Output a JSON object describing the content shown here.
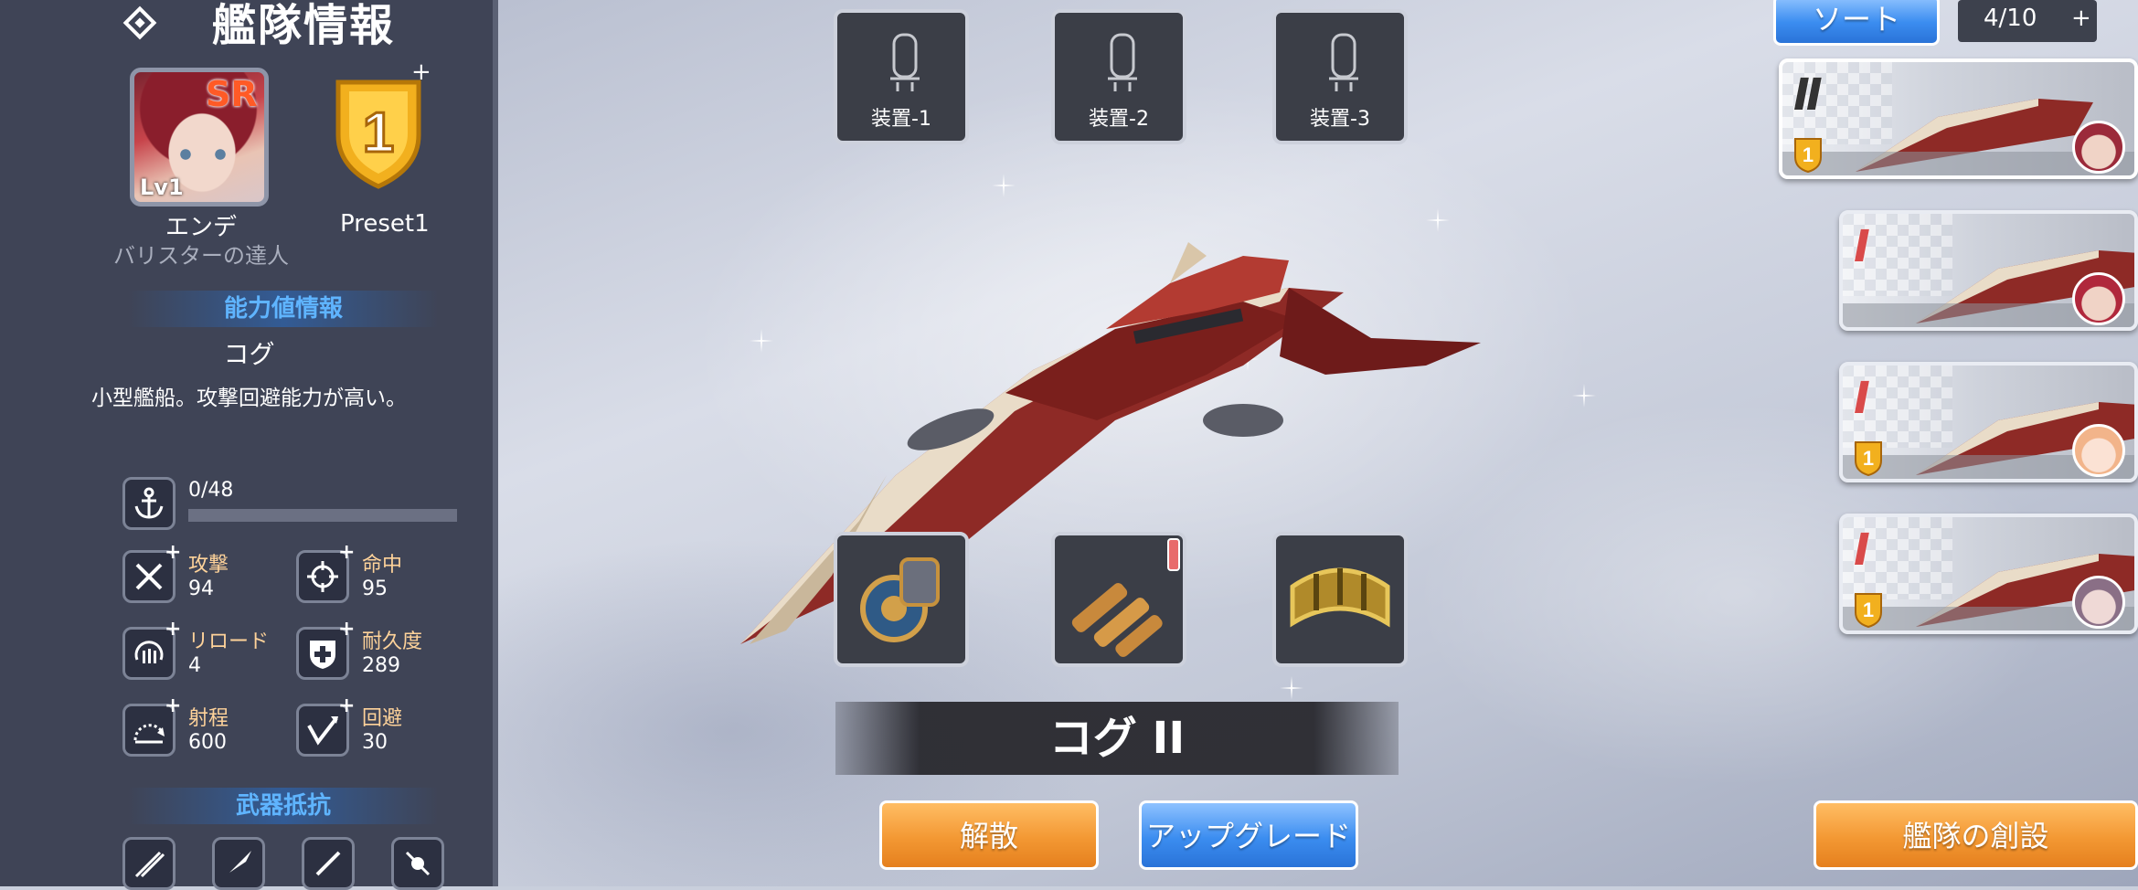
{
  "left_panel": {
    "title": "艦隊情報",
    "character": {
      "rarity": "SR",
      "level": "Lv1",
      "name": "エンデ",
      "title": "バリスターの達人"
    },
    "preset": {
      "number": "1",
      "label": "Preset1",
      "add": "+"
    },
    "ability_section": {
      "title": "能力値情報",
      "ship_type": "コグ",
      "description": "小型艦船。攻撃回避能力が高い。"
    },
    "cost": {
      "text": "0/48",
      "current": 0,
      "max": 48
    },
    "stats": [
      {
        "label": "攻撃",
        "value": "94",
        "icon": "crossed-swords-icon"
      },
      {
        "label": "命中",
        "value": "95",
        "icon": "crosshair-icon"
      },
      {
        "label": "リロード",
        "value": "4",
        "icon": "reload-icon"
      },
      {
        "label": "耐久度",
        "value": "289",
        "icon": "durability-shield-icon"
      },
      {
        "label": "射程",
        "value": "600",
        "icon": "range-icon"
      },
      {
        "label": "回避",
        "value": "30",
        "icon": "evasion-icon"
      }
    ],
    "weapon_section": {
      "title": "武器抵抗",
      "icons": [
        "arrows-icon",
        "missile-icon",
        "sword-icon",
        "bomb-icon"
      ]
    }
  },
  "center": {
    "equip_slots": [
      {
        "label": "装置-1"
      },
      {
        "label": "装置-2"
      },
      {
        "label": "装置-3"
      }
    ],
    "items": [
      {
        "icon": "gauntlet-cannon-icon"
      },
      {
        "icon": "ammo-shells-icon",
        "tier": "I"
      },
      {
        "icon": "brass-armor-icon"
      }
    ],
    "ship_name": "コグ II",
    "buttons": {
      "disband": "解散",
      "upgrade": "アップグレード"
    }
  },
  "right_panel": {
    "sort_label": "ソート",
    "fleet_count": "4/10",
    "fleet_add": "+",
    "create_fleet": "艦隊の創設",
    "fleet_cards": [
      {
        "tier": "II",
        "rank": "1",
        "hair_color": "#9b2a3a",
        "selected": true
      },
      {
        "tier": "I",
        "rank": "",
        "hair_color": "#b0283c",
        "selected": false
      },
      {
        "tier": "I",
        "rank": "1",
        "hair_color": "#f2b48a",
        "selected": false
      },
      {
        "tier": "I",
        "rank": "1",
        "hair_color": "#8a6f86",
        "selected": false
      }
    ]
  },
  "colors": {
    "panel_bg": "#3f4456",
    "accent_blue": "#5fb4ff",
    "stat_label": "#ffd39a",
    "button_orange": "#f39833",
    "button_blue": "#3b8df0",
    "shield_gold": "#f2b01e"
  }
}
